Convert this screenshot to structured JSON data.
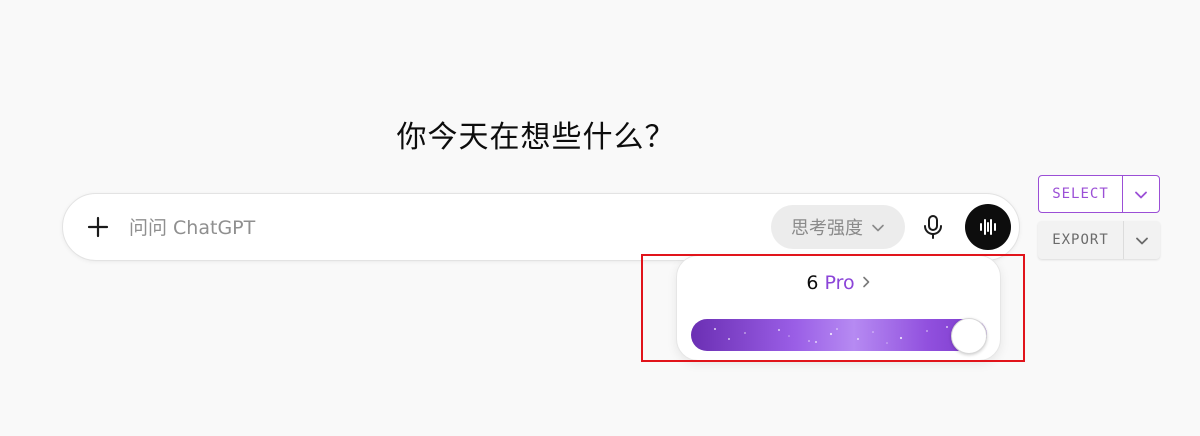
{
  "headline": "你今天在想些什么？",
  "composer": {
    "placeholder": "问问 ChatGPT",
    "plus_icon": "plus-icon",
    "thinking_pill": {
      "label": "思考强度",
      "icon": "chevron-down-icon"
    },
    "mic_icon": "microphone-icon",
    "voice_icon": "voice-waveform-icon"
  },
  "popover": {
    "model_number": "6",
    "model_tier": "Pro",
    "chevron_icon": "chevron-right-icon",
    "slider": {
      "level": 1.0,
      "gradient_start": "#6b2fb3",
      "gradient_end": "#7a38c8"
    }
  },
  "toolbar": {
    "select_label": "SELECT",
    "export_label": "EXPORT",
    "select_color": "#9b4fd6"
  },
  "annotation": {
    "highlight_color": "#e1141b"
  }
}
